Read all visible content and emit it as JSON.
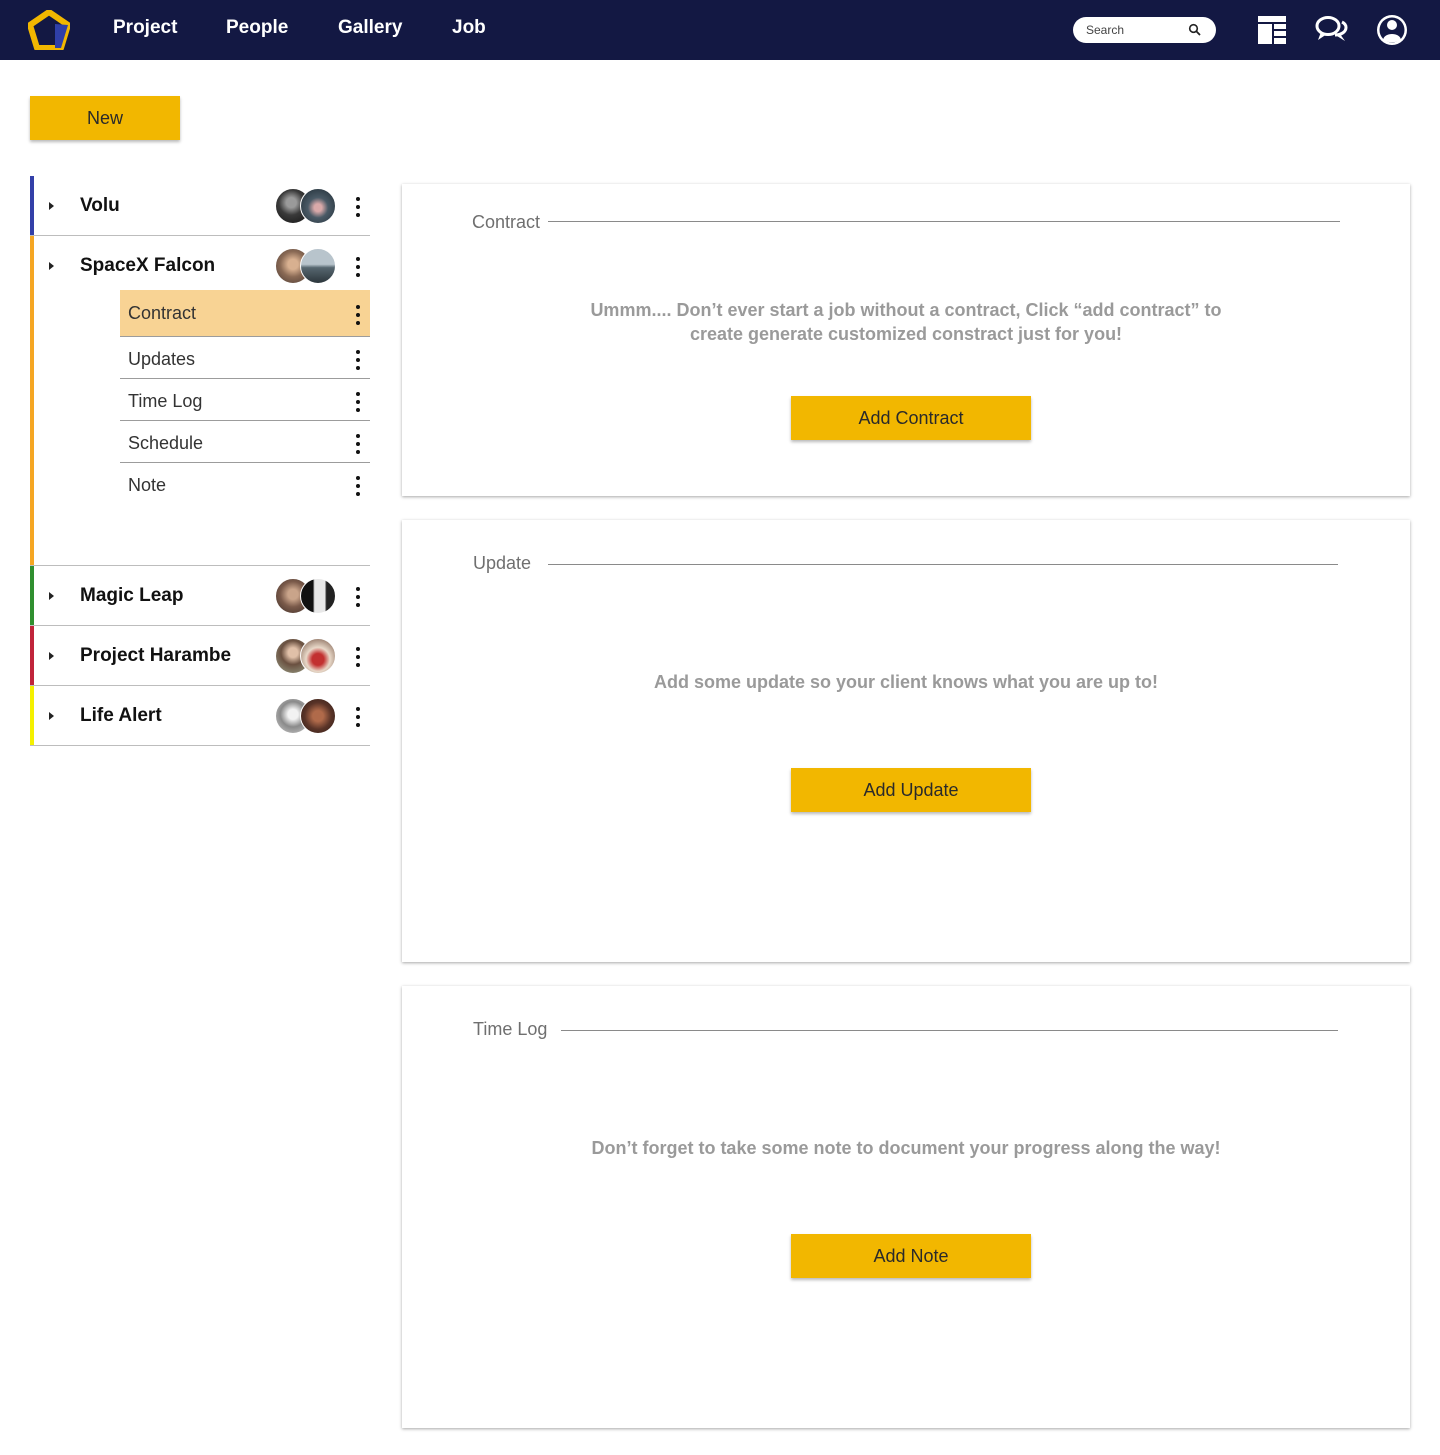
{
  "nav": {
    "links": [
      "Project",
      "People",
      "Gallery",
      "Job"
    ],
    "search_placeholder": "Search",
    "colors": {
      "bar": "#131843",
      "logo_primary": "#f2b700",
      "logo_secondary": "#2f3fa8"
    },
    "icons": [
      "logo-icon",
      "search-icon",
      "dashboard-icon",
      "chat-icon",
      "user-account-icon"
    ]
  },
  "toolbar": {
    "new_label": "New"
  },
  "sidebar": {
    "projects": [
      {
        "name": "Volu",
        "accent": "#3340a8"
      },
      {
        "name": "SpaceX Falcon",
        "accent": "#f5a623",
        "items": [
          "Contract",
          "Updates",
          "Time Log",
          "Schedule",
          "Note"
        ],
        "active_item": "Contract"
      },
      {
        "name": "Magic Leap",
        "accent": "#2f8f2f"
      },
      {
        "name": "Project Harambe",
        "accent": "#c0243a"
      },
      {
        "name": "Life Alert",
        "accent": "#f4f000"
      }
    ]
  },
  "cards": [
    {
      "title": "Contract",
      "message": "Ummm.... Don’t ever start a job without a contract, Click “add contract” to create generate customized constract just for you!",
      "button": "Add Contract"
    },
    {
      "title": "Update",
      "message": "Add some update so your client knows what you are up to!",
      "button": "Add Update"
    },
    {
      "title": "Time Log",
      "message": "Don’t forget to take some note to document your progress along the way!",
      "button": "Add Note"
    }
  ],
  "accent_color": "#f2b700",
  "active_row_color": "#f8d394"
}
